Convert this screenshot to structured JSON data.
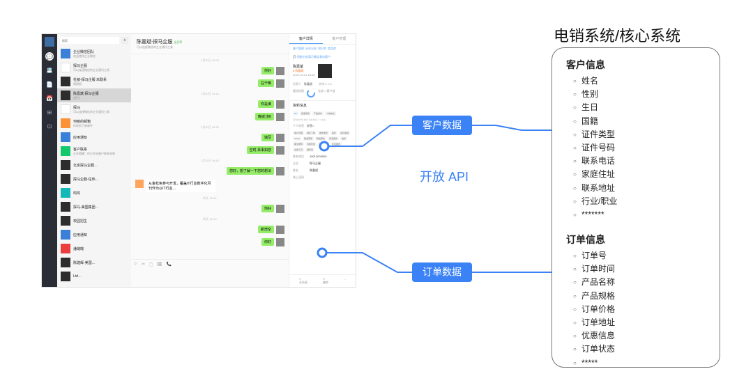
{
  "app": {
    "search_placeholder": "搜索",
    "chatlist": [
      {
        "name": "企业微信团队",
        "sub": "欢迎使用企业微信",
        "ava": "blue"
      },
      {
        "name": "探马企服",
        "sub": "可以连接微信的企业通讯工具",
        "ava": "white"
      },
      {
        "name": "杜敏-探马企服 未联系",
        "sub": "周周报",
        "ava": "dark"
      },
      {
        "name": "陈嘉斌-探马企服",
        "sub": "[图片]",
        "ava": "dark",
        "sel": true
      },
      {
        "name": "探马",
        "sub": "可以连接微信的企业通讯工具",
        "ava": "white"
      },
      {
        "name": "何敏的邮箱",
        "sub": "你收到了新邮件",
        "ava": "orange"
      },
      {
        "name": "应用通知",
        "sub": "",
        "ava": "blue"
      },
      {
        "name": "客户联系",
        "sub": "企业提醒：你已开启客户联系权限",
        "ava": "green"
      },
      {
        "name": "北京探马企服…",
        "sub": "",
        "ava": "dark"
      },
      {
        "name": "探马企服-任伟…",
        "sub": "",
        "ava": "dark"
      },
      {
        "name": "鸣鸣",
        "sub": "",
        "ava": "teal"
      },
      {
        "name": "探马-美国集团…",
        "sub": "",
        "ava": "dark"
      },
      {
        "name": "校园招生",
        "sub": "",
        "ava": "dark"
      },
      {
        "name": "应用通知",
        "sub": "",
        "ava": "blue"
      },
      {
        "name": "潘璐璐",
        "sub": "",
        "ava": "red"
      },
      {
        "name": "陈建辉-美国…",
        "sub": "",
        "ava": "dark"
      },
      {
        "name": "Ltd…",
        "sub": "",
        "ava": "dark"
      }
    ],
    "chat": {
      "title": "陈嘉斌-探马企服",
      "title_badge": "全员等",
      "sub": "可以连接微信的企业通讯工具",
      "timestamps": [
        "2月20日 10:09",
        "2月20日 13:14",
        "2月20日 15:33",
        "2月21日 18:43",
        "昨天 15:34",
        "昨天 16:13"
      ],
      "replies": [
        "你好",
        "在干嘛",
        "你是谁",
        "晚城 [好]",
        "填写",
        "空时,事事如您",
        "新增空"
      ],
      "msg_out": "您好，想了解一下您的想法",
      "msg_in": "从金松氧参与开发，覆盖IT行业数字化月刊作为以IT行业…"
    },
    "side": {
      "tabs": [
        "客户详情",
        "客户管理",
        "历史记录",
        "知识库",
        "商品库"
      ],
      "intent_hint": "智能分析离已确定意向客户",
      "name": "陈嘉斌",
      "date": "2020-04-01 16:28",
      "owner_label": "负责人",
      "owner": "陈嘉斌",
      "cooperators": "协作人 2人",
      "stage_label": "跟进阶段",
      "stage_opts": "全部 > 客户组",
      "section_profile": "资料信息",
      "company_tags": [
        "BP",
        "微课通知",
        "产品操作",
        "人物信息"
      ],
      "company_tags_line2": "经济类市场  教育  商会电话  个人信息",
      "personal": "个人标签",
      "personal_v": "标签>",
      "content_tags": [
        "客户管理",
        "销售下单",
        "推送通知",
        "美印",
        "会员答题",
        "SAAS",
        "群发营销",
        "群发服务",
        "应用服务",
        "数学",
        "图文推荐",
        "内部管控",
        "客户管理",
        "红包推送",
        "企微工具",
        "辅导班"
      ],
      "phone_label": "联系电话",
      "phone": "15012002003",
      "co_label": "企业",
      "co": "探马企服",
      "clerk_label": "姓名",
      "clerk": "陈嘉斌",
      "source_label": "线上官网",
      "source": "",
      "bottom": [
        "关系图",
        "编辑",
        "..."
      ]
    }
  },
  "diagram": {
    "api_label": "开放 API",
    "badge1": "客户数据",
    "badge2": "订单数据"
  },
  "right": {
    "title": "电销系统/核心系统",
    "customer_header": "客户信息",
    "customer_fields": [
      "姓名",
      "性别",
      "生日",
      "国籍",
      "证件类型",
      "证件号码",
      "联系电话",
      "家庭住址",
      "联系地址",
      "行业/职业",
      "*******"
    ],
    "order_header": "订单信息",
    "order_fields": [
      "订单号",
      "订单时间",
      "产品名称",
      "产品规格",
      "订单价格",
      "订单地址",
      "优惠信息",
      "订单状态",
      "*****"
    ]
  }
}
